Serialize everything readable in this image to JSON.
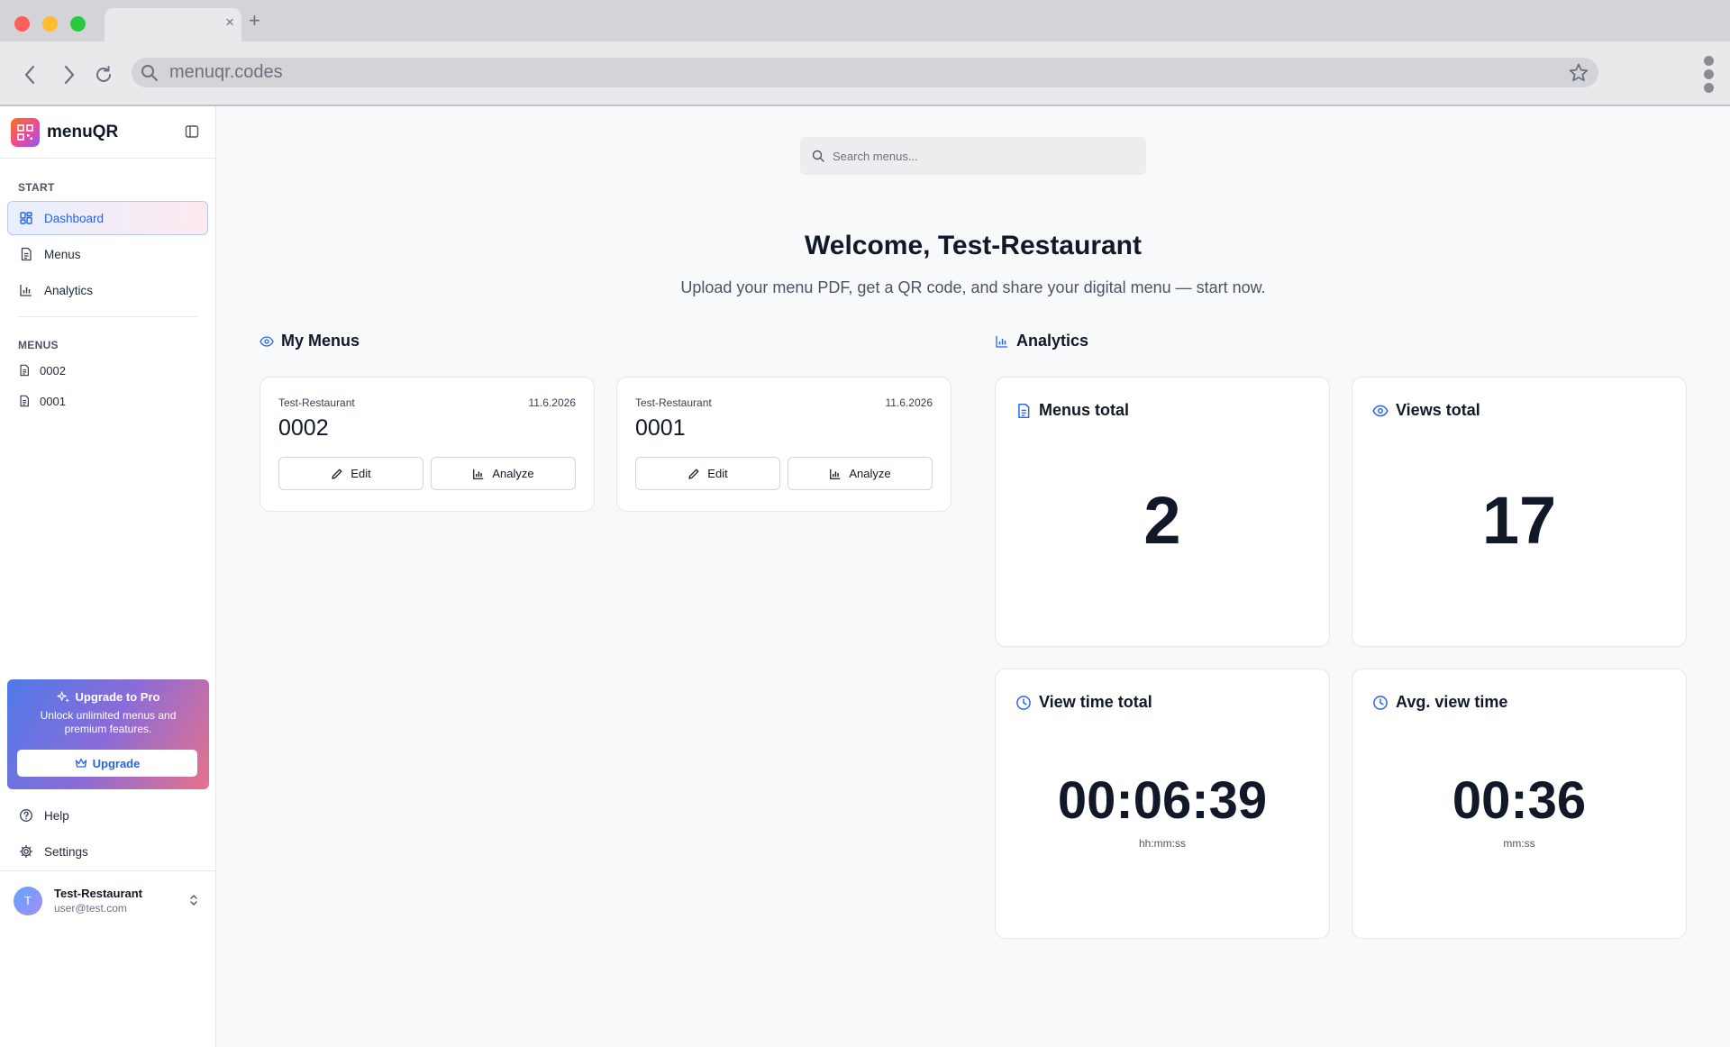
{
  "browser": {
    "url": "menuqr.codes"
  },
  "sidebar": {
    "brand": "menuQR",
    "start_label": "START",
    "nav": [
      {
        "label": "Dashboard"
      },
      {
        "label": "Menus"
      },
      {
        "label": "Analytics"
      }
    ],
    "menus_label": "MENUS",
    "menus": [
      {
        "label": "0002"
      },
      {
        "label": "0001"
      }
    ],
    "upgrade": {
      "title": "Upgrade to Pro",
      "text": "Unlock unlimited menus and premium features.",
      "button": "Upgrade"
    },
    "help": "Help",
    "settings": "Settings",
    "user": {
      "initial": "T",
      "name": "Test-Restaurant",
      "email": "user@test.com"
    }
  },
  "main": {
    "search_placeholder": "Search menus...",
    "welcome": "Welcome, Test-Restaurant",
    "subtitle": "Upload your menu PDF, get a QR code, and share your digital menu — start now.",
    "my_menus_title": "My Menus",
    "analytics_title": "Analytics",
    "menu_cards": [
      {
        "restaurant": "Test-Restaurant",
        "date": "11.6.2026",
        "name": "0002",
        "edit": "Edit",
        "analyze": "Analyze"
      },
      {
        "restaurant": "Test-Restaurant",
        "date": "11.6.2026",
        "name": "0001",
        "edit": "Edit",
        "analyze": "Analyze"
      }
    ],
    "stats": [
      {
        "title": "Menus total",
        "value": "2"
      },
      {
        "title": "Views total",
        "value": "17"
      },
      {
        "title": "View time total",
        "value": "00:06:39",
        "unit": "hh:mm:ss"
      },
      {
        "title": "Avg. view time",
        "value": "00:36",
        "unit": "mm:ss"
      }
    ]
  },
  "colors": {
    "accent": "#2563eb",
    "active_bg": "#e8efff",
    "traffic_red": "#fe5f57",
    "traffic_yellow": "#febc2e",
    "traffic_green": "#28c840"
  }
}
